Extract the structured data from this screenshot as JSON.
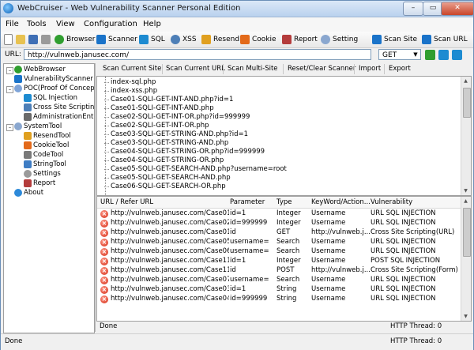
{
  "app": {
    "title": "WebCruiser - Web Vulnerability Scanner Personal Edition"
  },
  "window_controls": {
    "minimize": "–",
    "maximize": "▭",
    "close": "✕"
  },
  "menu": [
    "File",
    "Tools",
    "View",
    "Configuration",
    "Help"
  ],
  "toolbar": {
    "browser": "Browser",
    "scanner": "Scanner",
    "sql": "SQL",
    "xss": "XSS",
    "resend": "Resend",
    "cookie": "Cookie",
    "report": "Report",
    "setting": "Setting",
    "scan_site": "Scan Site",
    "scan_url": "Scan URL"
  },
  "url_bar": {
    "label": "URL:",
    "value": "http://vulnweb.janusec.com/",
    "method": "GET"
  },
  "tree": {
    "items": [
      {
        "label": "WebBrowser",
        "icon": "globe-icon",
        "color": "#2f9e2f"
      },
      {
        "label": "VulnerabilityScanner",
        "icon": "scanner-icon",
        "color": "#1a73c9"
      },
      {
        "label": "POC(Proof Of Concept)",
        "icon": "poc-icon",
        "color": "#7fa4d8"
      },
      {
        "label": "SQL Injection",
        "icon": "sql-icon",
        "color": "#1d8bd1"
      },
      {
        "label": "Cross Site Scripting",
        "icon": "xss-icon",
        "color": "#4d7fb7"
      },
      {
        "label": "AdministrationEntrance",
        "icon": "admin-icon",
        "color": "#6a6a6a"
      },
      {
        "label": "SystemTool",
        "icon": "gear-icon",
        "color": "#8aa7cf"
      },
      {
        "label": "ResendTool",
        "icon": "resend-icon",
        "color": "#e0a020"
      },
      {
        "label": "CookieTool",
        "icon": "cookie-icon",
        "color": "#e36a1a"
      },
      {
        "label": "CodeTool",
        "icon": "code-icon",
        "color": "#7a7a7a"
      },
      {
        "label": "StringTool",
        "icon": "string-icon",
        "color": "#3f7dc4"
      },
      {
        "label": "Settings",
        "icon": "settings-icon",
        "color": "#9a9a9a"
      },
      {
        "label": "Report",
        "icon": "report-icon",
        "color": "#b43c3c"
      },
      {
        "label": "About",
        "icon": "about-icon",
        "color": "#2c89d9"
      }
    ]
  },
  "scanner_buttons": [
    "Scan Current Site",
    "Scan Current URL",
    "Scan Multi-Site",
    "Reset/Clear Scanner",
    "Import",
    "Export"
  ],
  "files": [
    "index-sql.php",
    "index-xss.php",
    "Case01-SQLI-GET-INT-AND.php?id=1",
    "Case01-SQLI-GET-INT-AND.php",
    "Case02-SQLI-GET-INT-OR.php?id=999999",
    "Case02-SQLI-GET-INT-OR.php",
    "Case03-SQLI-GET-STRING-AND.php?id=1",
    "Case03-SQLI-GET-STRING-AND.php",
    "Case04-SQLI-GET-STRING-OR.php?id=999999",
    "Case04-SQLI-GET-STRING-OR.php",
    "Case05-SQLI-GET-SEARCH-AND.php?username=root",
    "Case05-SQLI-GET-SEARCH-AND.php",
    "Case06-SQLI-GET-SEARCH-OR.php"
  ],
  "results": {
    "headers": [
      "URL / Refer URL",
      "Parameter",
      "Type",
      "KeyWord/Action...",
      "Vulnerability"
    ],
    "rows": [
      [
        "http://vulnweb.janusec.com/Case01-S...",
        "id=1",
        "Integer",
        "Username",
        "URL SQL INJECTION"
      ],
      [
        "http://vulnweb.janusec.com/Case02-S...",
        "id=999999",
        "Integer",
        "Username",
        "URL SQL INJECTION"
      ],
      [
        "http://vulnweb.janusec.com/Case01-S...",
        "id",
        "GET",
        "http://vulnweb.j...",
        "Cross Site Scripting(URL)"
      ],
      [
        "http://vulnweb.janusec.com/Case05-S...",
        "username=",
        "Search",
        "Username",
        "URL SQL INJECTION"
      ],
      [
        "http://vulnweb.janusec.com/Case06-S...",
        "username=",
        "Search",
        "Username",
        "URL SQL INJECTION"
      ],
      [
        "http://vulnweb.janusec.com/Case11-S...",
        "id=1",
        "Integer",
        "Username",
        "POST SQL INJECTION"
      ],
      [
        "http://vulnweb.janusec.com/Case11-S...",
        "id",
        "POST",
        "http://vulnweb.j...",
        "Cross Site Scripting(Form)"
      ],
      [
        "http://vulnweb.janusec.com/Case07-S...",
        "username=",
        "Search",
        "Username",
        "URL SQL INJECTION"
      ],
      [
        "http://vulnweb.janusec.com/Case03-S...",
        "id=1",
        "String",
        "Username",
        "URL SQL INJECTION"
      ],
      [
        "http://vulnweb.janusec.com/Case04-S...",
        "id=999999",
        "String",
        "Username",
        "URL SQL INJECTION"
      ]
    ]
  },
  "status_inner": {
    "left": "Done",
    "right": "HTTP Thread: 0"
  },
  "status_outer": {
    "left": "Done",
    "right": "HTTP Thread: 0"
  }
}
